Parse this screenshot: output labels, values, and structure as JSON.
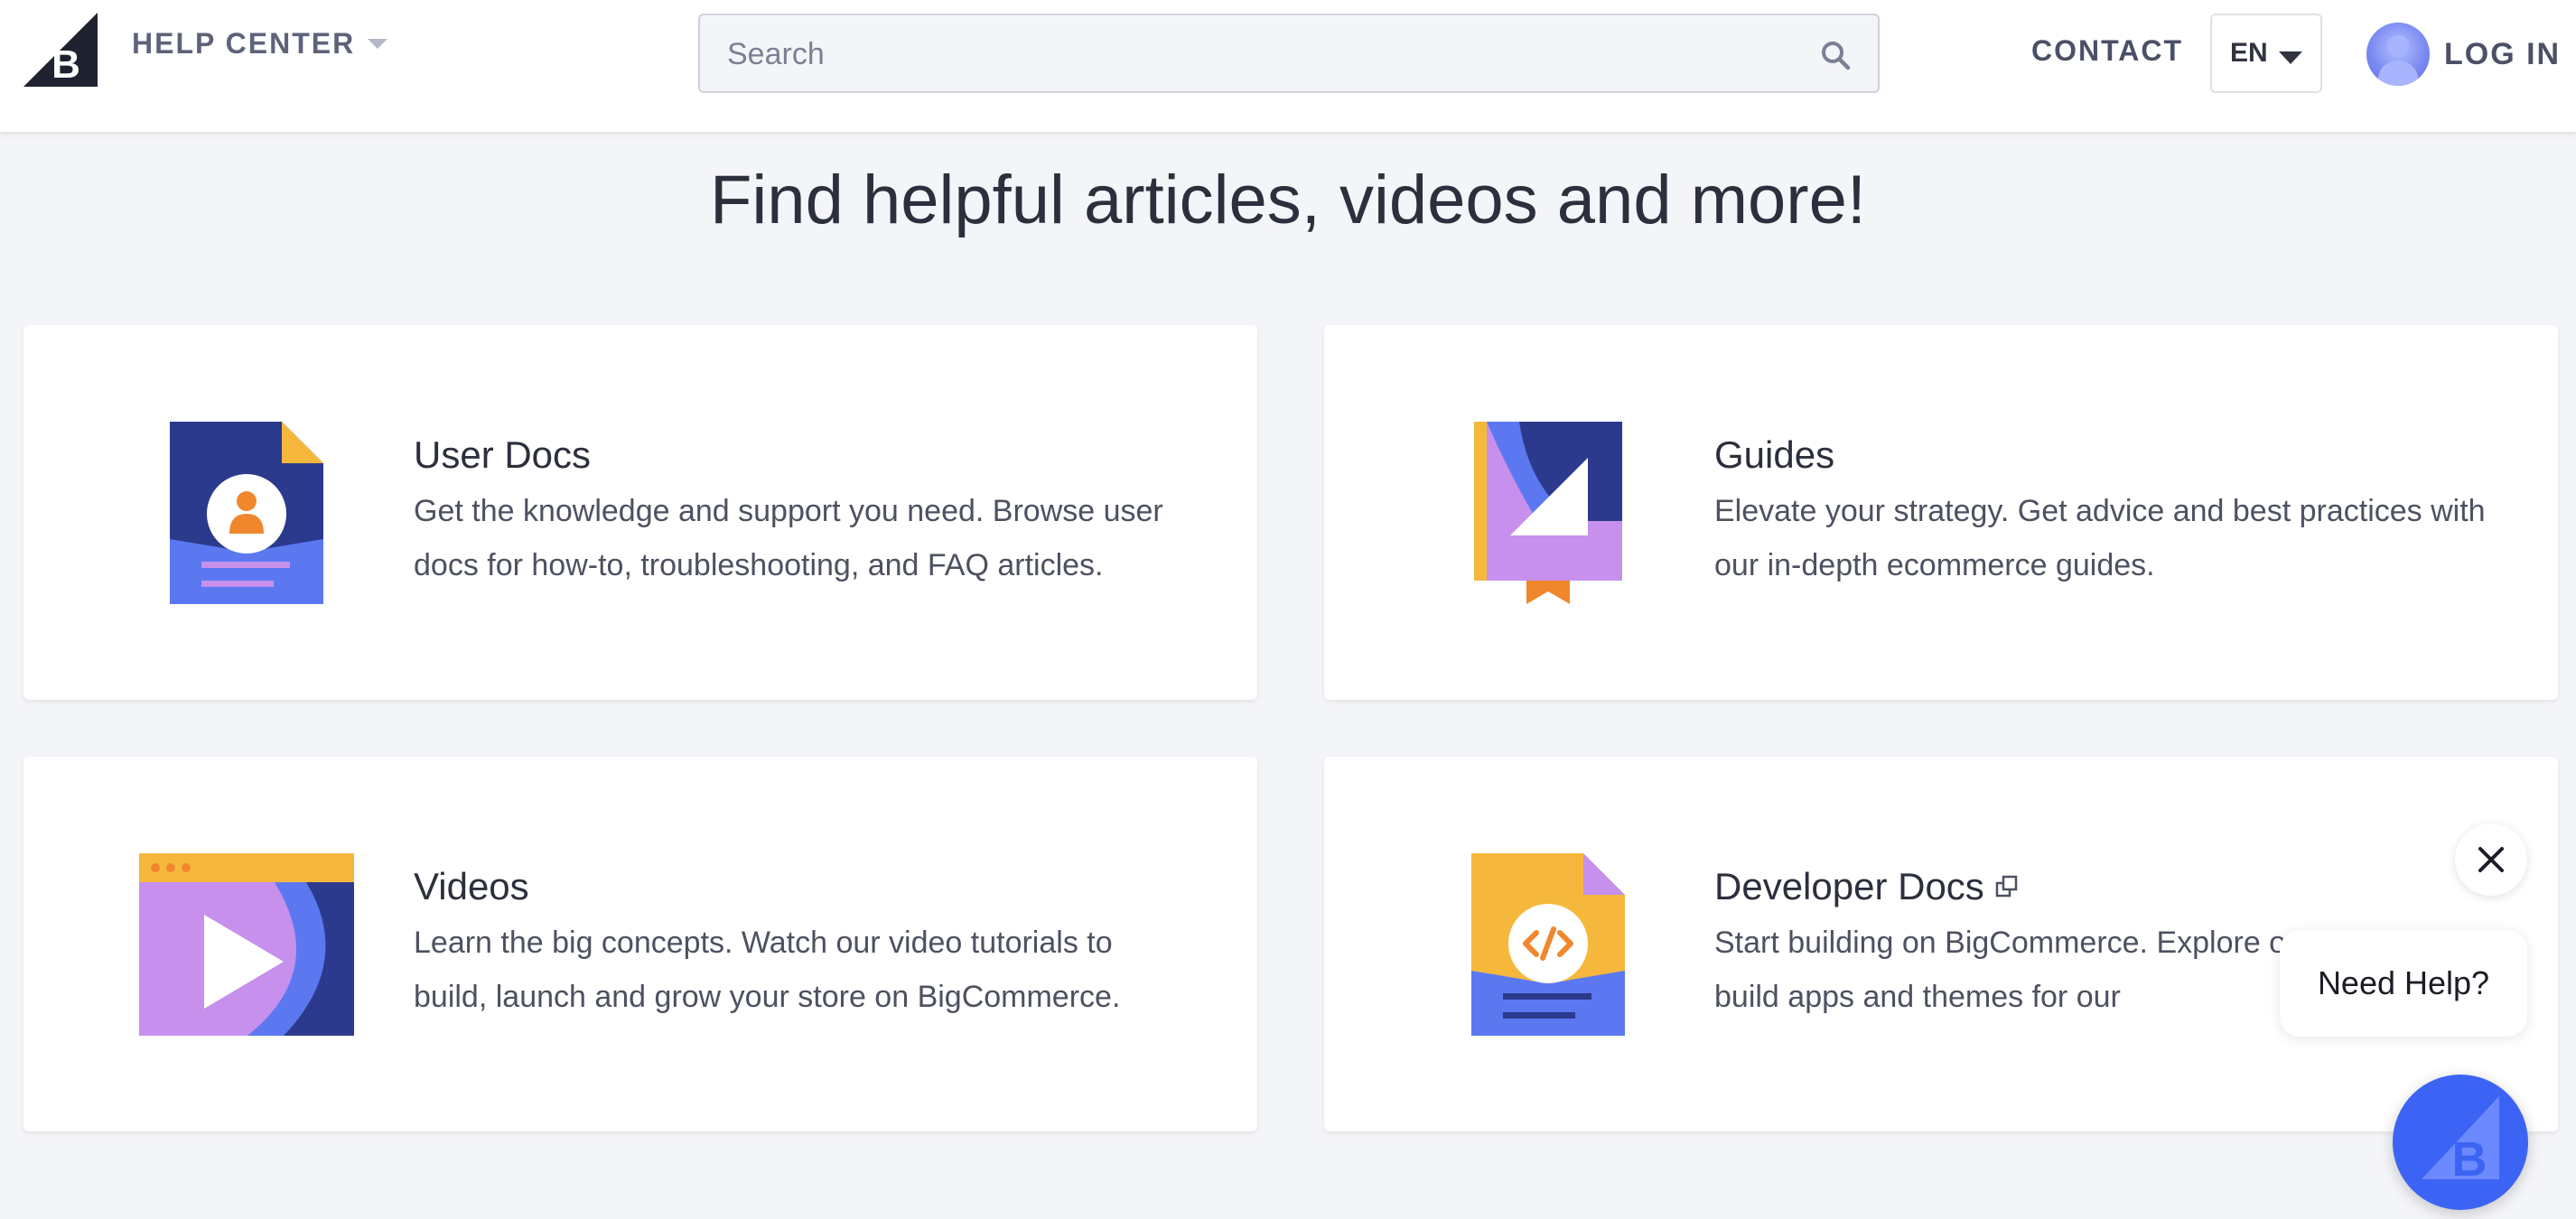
{
  "header": {
    "brand_label": "HELP CENTER",
    "search_placeholder": "Search",
    "contact_label": "CONTACT",
    "language_code": "EN",
    "login_label": "LOG IN"
  },
  "main": {
    "headline": "Find helpful articles, videos and more!",
    "cards": [
      {
        "title": "User Docs",
        "description": "Get the knowledge and support you need. Browse user docs for how-to, troubleshooting, and FAQ articles.",
        "icon": "user-docs-icon"
      },
      {
        "title": "Guides",
        "description": "Elevate your strategy. Get advice and best practices with our in-depth ecommerce guides.",
        "icon": "guide-book-icon"
      },
      {
        "title": "Videos",
        "description": "Learn the big concepts. Watch our video tutorials to build, launch and grow your store on BigCommerce.",
        "icon": "video-player-icon"
      },
      {
        "title": "Developer Docs",
        "description": "Start building on BigCommerce. Explore our dev docs to build apps and themes for our",
        "icon": "code-doc-icon"
      }
    ]
  },
  "chat": {
    "bubble_text": "Need Help?"
  },
  "colors": {
    "navy": "#2b3a8c",
    "blue": "#5b78f0",
    "orange": "#f0872d",
    "yellow": "#f5b83d",
    "lavender": "#c690ec",
    "launcher": "#3c64f4"
  }
}
